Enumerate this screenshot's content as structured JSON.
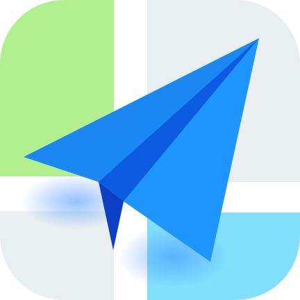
{
  "icon": {
    "subject": "paper-plane-icon",
    "colors": {
      "background": "#ffffff",
      "tile_top_left": "#b1ef8f",
      "tile_top_right": "#e9eff0",
      "tile_bottom_left": "#e8eff0",
      "tile_bottom_right": "#83e0fd",
      "glow": "#3f8cff",
      "plane_main": "#1a87f2",
      "plane_light": "#1f96ff",
      "plane_dark": "#0b5ce0",
      "plane_shadow": "#0a3fc6"
    }
  }
}
